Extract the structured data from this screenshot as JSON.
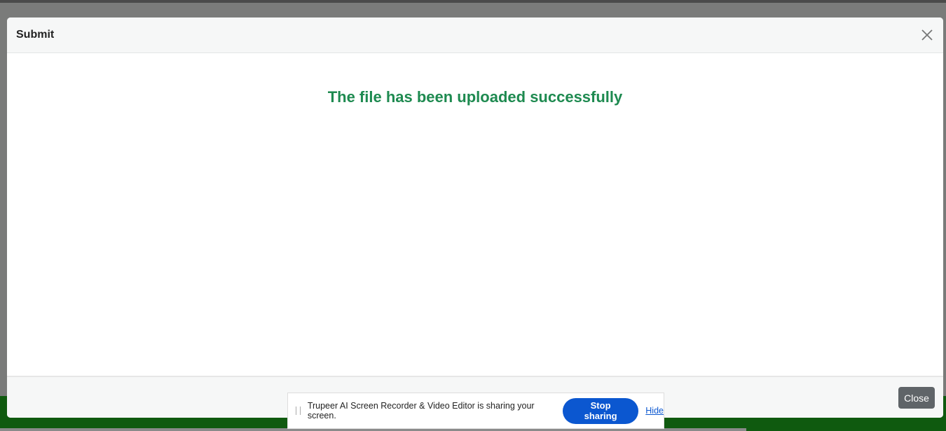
{
  "dialog": {
    "title": "Submit",
    "message": "The file has been uploaded successfully",
    "close_button_label": "Close",
    "close_icon": "close-icon",
    "colors": {
      "message": "#1e8a50",
      "close_button": "#5f6468"
    }
  },
  "share_bar": {
    "message": "Trupeer AI Screen Recorder & Video Editor is sharing your screen.",
    "stop_label": "Stop sharing",
    "hide_label": "Hide",
    "colors": {
      "stop_button": "#0b57d0"
    }
  }
}
